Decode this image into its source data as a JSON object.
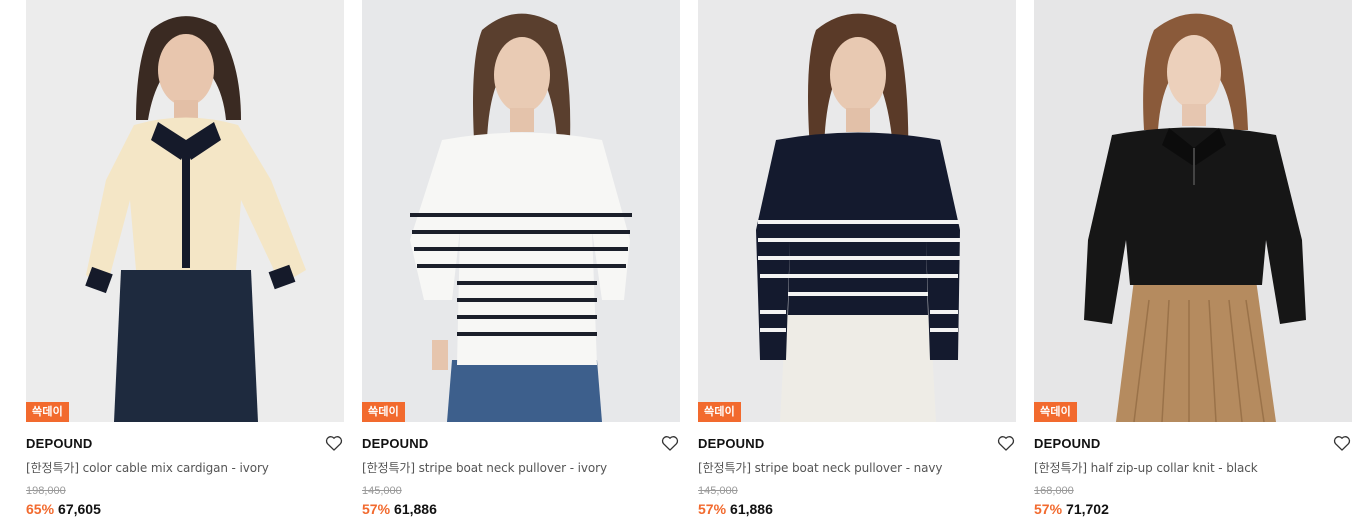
{
  "accent_color": "#f26a2e",
  "products": [
    {
      "badge": "쓱데이",
      "brand": "DEPOUND",
      "title": "[한정특가] color cable mix cardigan - ivory",
      "original_price": "198,000",
      "discount": "65%",
      "price": "67,605",
      "wishlist_icon": "heart-outline-icon"
    },
    {
      "badge": "쓱데이",
      "brand": "DEPOUND",
      "title": "[한정특가] stripe boat neck pullover - ivory",
      "original_price": "145,000",
      "discount": "57%",
      "price": "61,886",
      "wishlist_icon": "heart-outline-icon"
    },
    {
      "badge": "쓱데이",
      "brand": "DEPOUND",
      "title": "[한정특가] stripe boat neck pullover - navy",
      "original_price": "145,000",
      "discount": "57%",
      "price": "61,886",
      "wishlist_icon": "heart-outline-icon"
    },
    {
      "badge": "쓱데이",
      "brand": "DEPOUND",
      "title": "[한정특가] half zip-up collar knit - black",
      "original_price": "168,000",
      "discount": "57%",
      "price": "71,702",
      "wishlist_icon": "heart-outline-icon"
    }
  ]
}
